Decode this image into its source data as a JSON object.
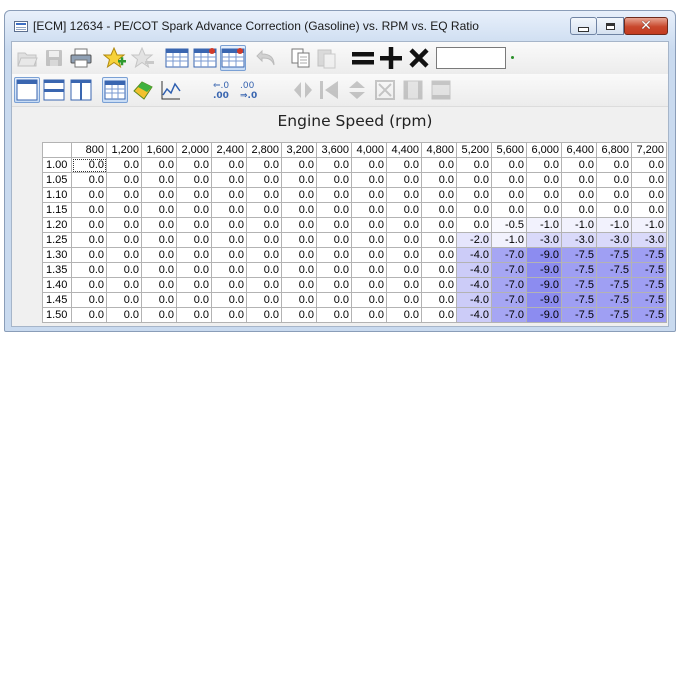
{
  "window": {
    "title": "[ECM] 12634 - PE/COT Spark Advance Correction (Gasoline) vs. RPM vs. EQ Ratio"
  },
  "toolbar": {
    "value_input": "",
    "row1_icons": [
      "open-folder-icon",
      "save-icon",
      "print-icon",
      "add-favorite-icon",
      "remove-favorite-icon",
      "table-icon",
      "table-compare-icon",
      "table-selected-icon",
      "undo-icon",
      "copy-icon",
      "paste-icon",
      "equals-icon",
      "plus-icon",
      "multiply-icon"
    ],
    "row2_icons": [
      "single-view-icon",
      "split-horizontal-icon",
      "split-vertical-icon",
      "table-view-icon",
      "3d-surface-icon",
      "graph-icon",
      "decimal-decrease-icon",
      "decimal-increase-icon",
      "interpolate-horizontal-icon",
      "interpolate-left-icon",
      "interpolate-vertical-icon",
      "interpolate-all-icon",
      "smooth-horizontal-icon",
      "smooth-vertical-icon"
    ]
  },
  "axis_title": "Engine Speed (rpm)",
  "table": {
    "columns": [
      "800",
      "1,200",
      "1,600",
      "2,000",
      "2,400",
      "2,800",
      "3,200",
      "3,600",
      "4,000",
      "4,400",
      "4,800",
      "5,200",
      "5,600",
      "6,000",
      "6,400",
      "6,800",
      "7,200"
    ],
    "rows": [
      {
        "label": "1.00",
        "values": [
          "0.0",
          "0.0",
          "0.0",
          "0.0",
          "0.0",
          "0.0",
          "0.0",
          "0.0",
          "0.0",
          "0.0",
          "0.0",
          "0.0",
          "0.0",
          "0.0",
          "0.0",
          "0.0",
          "0.0"
        ]
      },
      {
        "label": "1.05",
        "values": [
          "0.0",
          "0.0",
          "0.0",
          "0.0",
          "0.0",
          "0.0",
          "0.0",
          "0.0",
          "0.0",
          "0.0",
          "0.0",
          "0.0",
          "0.0",
          "0.0",
          "0.0",
          "0.0",
          "0.0"
        ]
      },
      {
        "label": "1.10",
        "values": [
          "0.0",
          "0.0",
          "0.0",
          "0.0",
          "0.0",
          "0.0",
          "0.0",
          "0.0",
          "0.0",
          "0.0",
          "0.0",
          "0.0",
          "0.0",
          "0.0",
          "0.0",
          "0.0",
          "0.0"
        ]
      },
      {
        "label": "1.15",
        "values": [
          "0.0",
          "0.0",
          "0.0",
          "0.0",
          "0.0",
          "0.0",
          "0.0",
          "0.0",
          "0.0",
          "0.0",
          "0.0",
          "0.0",
          "0.0",
          "0.0",
          "0.0",
          "0.0",
          "0.0"
        ]
      },
      {
        "label": "1.20",
        "values": [
          "0.0",
          "0.0",
          "0.0",
          "0.0",
          "0.0",
          "0.0",
          "0.0",
          "0.0",
          "0.0",
          "0.0",
          "0.0",
          "0.0",
          "-0.5",
          "-1.0",
          "-1.0",
          "-1.0",
          "-1.0"
        ]
      },
      {
        "label": "1.25",
        "values": [
          "0.0",
          "0.0",
          "0.0",
          "0.0",
          "0.0",
          "0.0",
          "0.0",
          "0.0",
          "0.0",
          "0.0",
          "0.0",
          "-2.0",
          "-1.0",
          "-3.0",
          "-3.0",
          "-3.0",
          "-3.0"
        ]
      },
      {
        "label": "1.30",
        "values": [
          "0.0",
          "0.0",
          "0.0",
          "0.0",
          "0.0",
          "0.0",
          "0.0",
          "0.0",
          "0.0",
          "0.0",
          "0.0",
          "-4.0",
          "-7.0",
          "-9.0",
          "-7.5",
          "-7.5",
          "-7.5"
        ]
      },
      {
        "label": "1.35",
        "values": [
          "0.0",
          "0.0",
          "0.0",
          "0.0",
          "0.0",
          "0.0",
          "0.0",
          "0.0",
          "0.0",
          "0.0",
          "0.0",
          "-4.0",
          "-7.0",
          "-9.0",
          "-7.5",
          "-7.5",
          "-7.5"
        ]
      },
      {
        "label": "1.40",
        "values": [
          "0.0",
          "0.0",
          "0.0",
          "0.0",
          "0.0",
          "0.0",
          "0.0",
          "0.0",
          "0.0",
          "0.0",
          "0.0",
          "-4.0",
          "-7.0",
          "-9.0",
          "-7.5",
          "-7.5",
          "-7.5"
        ]
      },
      {
        "label": "1.45",
        "values": [
          "0.0",
          "0.0",
          "0.0",
          "0.0",
          "0.0",
          "0.0",
          "0.0",
          "0.0",
          "0.0",
          "0.0",
          "0.0",
          "-4.0",
          "-7.0",
          "-9.0",
          "-7.5",
          "-7.5",
          "-7.5"
        ]
      },
      {
        "label": "1.50",
        "values": [
          "0.0",
          "0.0",
          "0.0",
          "0.0",
          "0.0",
          "0.0",
          "0.0",
          "0.0",
          "0.0",
          "0.0",
          "0.0",
          "-4.0",
          "-7.0",
          "-9.0",
          "-7.5",
          "-7.5",
          "-7.5"
        ]
      }
    ],
    "selected_cell": [
      0,
      0
    ],
    "color_scale": {
      "zero": "#ffffff",
      "min": "#8c8cf0"
    }
  }
}
